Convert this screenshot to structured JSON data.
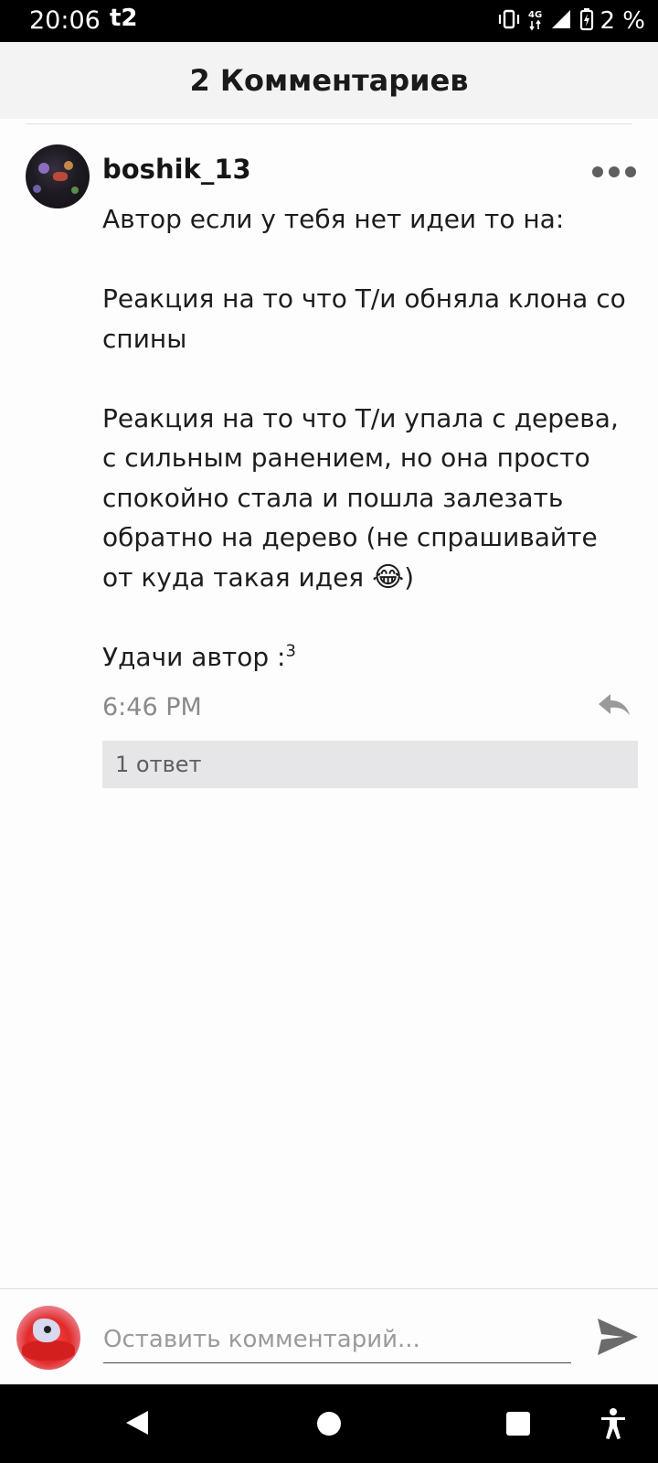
{
  "status_bar": {
    "time": "20:06",
    "carrier": "t2",
    "network": "4G",
    "battery": "2 %"
  },
  "header": {
    "title": "2 Комментариев"
  },
  "comment": {
    "author": "boshik_13",
    "paragraphs": [
      "Автор если у тебя нет идеи то на:",
      "Реакция  на то что Т/и обняла клона со спины",
      "Реакция на то что Т/и упала с дерева, с сильным ранением, но она просто спокойно стала и пошла залезать обратно на дерево (не спрашивайте от куда такая идея"
    ],
    "emoji": "😂",
    "closing_paren": ")",
    "signoff": "Удачи автор :",
    "signoff_sup": "3",
    "timestamp": "6:46 PM",
    "replies_label": "1 ответ"
  },
  "composer": {
    "placeholder": "Оставить комментарий..."
  },
  "icons": {
    "more": "more-horizontal-icon",
    "reply": "reply-arrow-icon",
    "send": "send-icon",
    "nav": [
      "back-icon",
      "home-icon",
      "recents-icon",
      "accessibility-icon"
    ]
  }
}
